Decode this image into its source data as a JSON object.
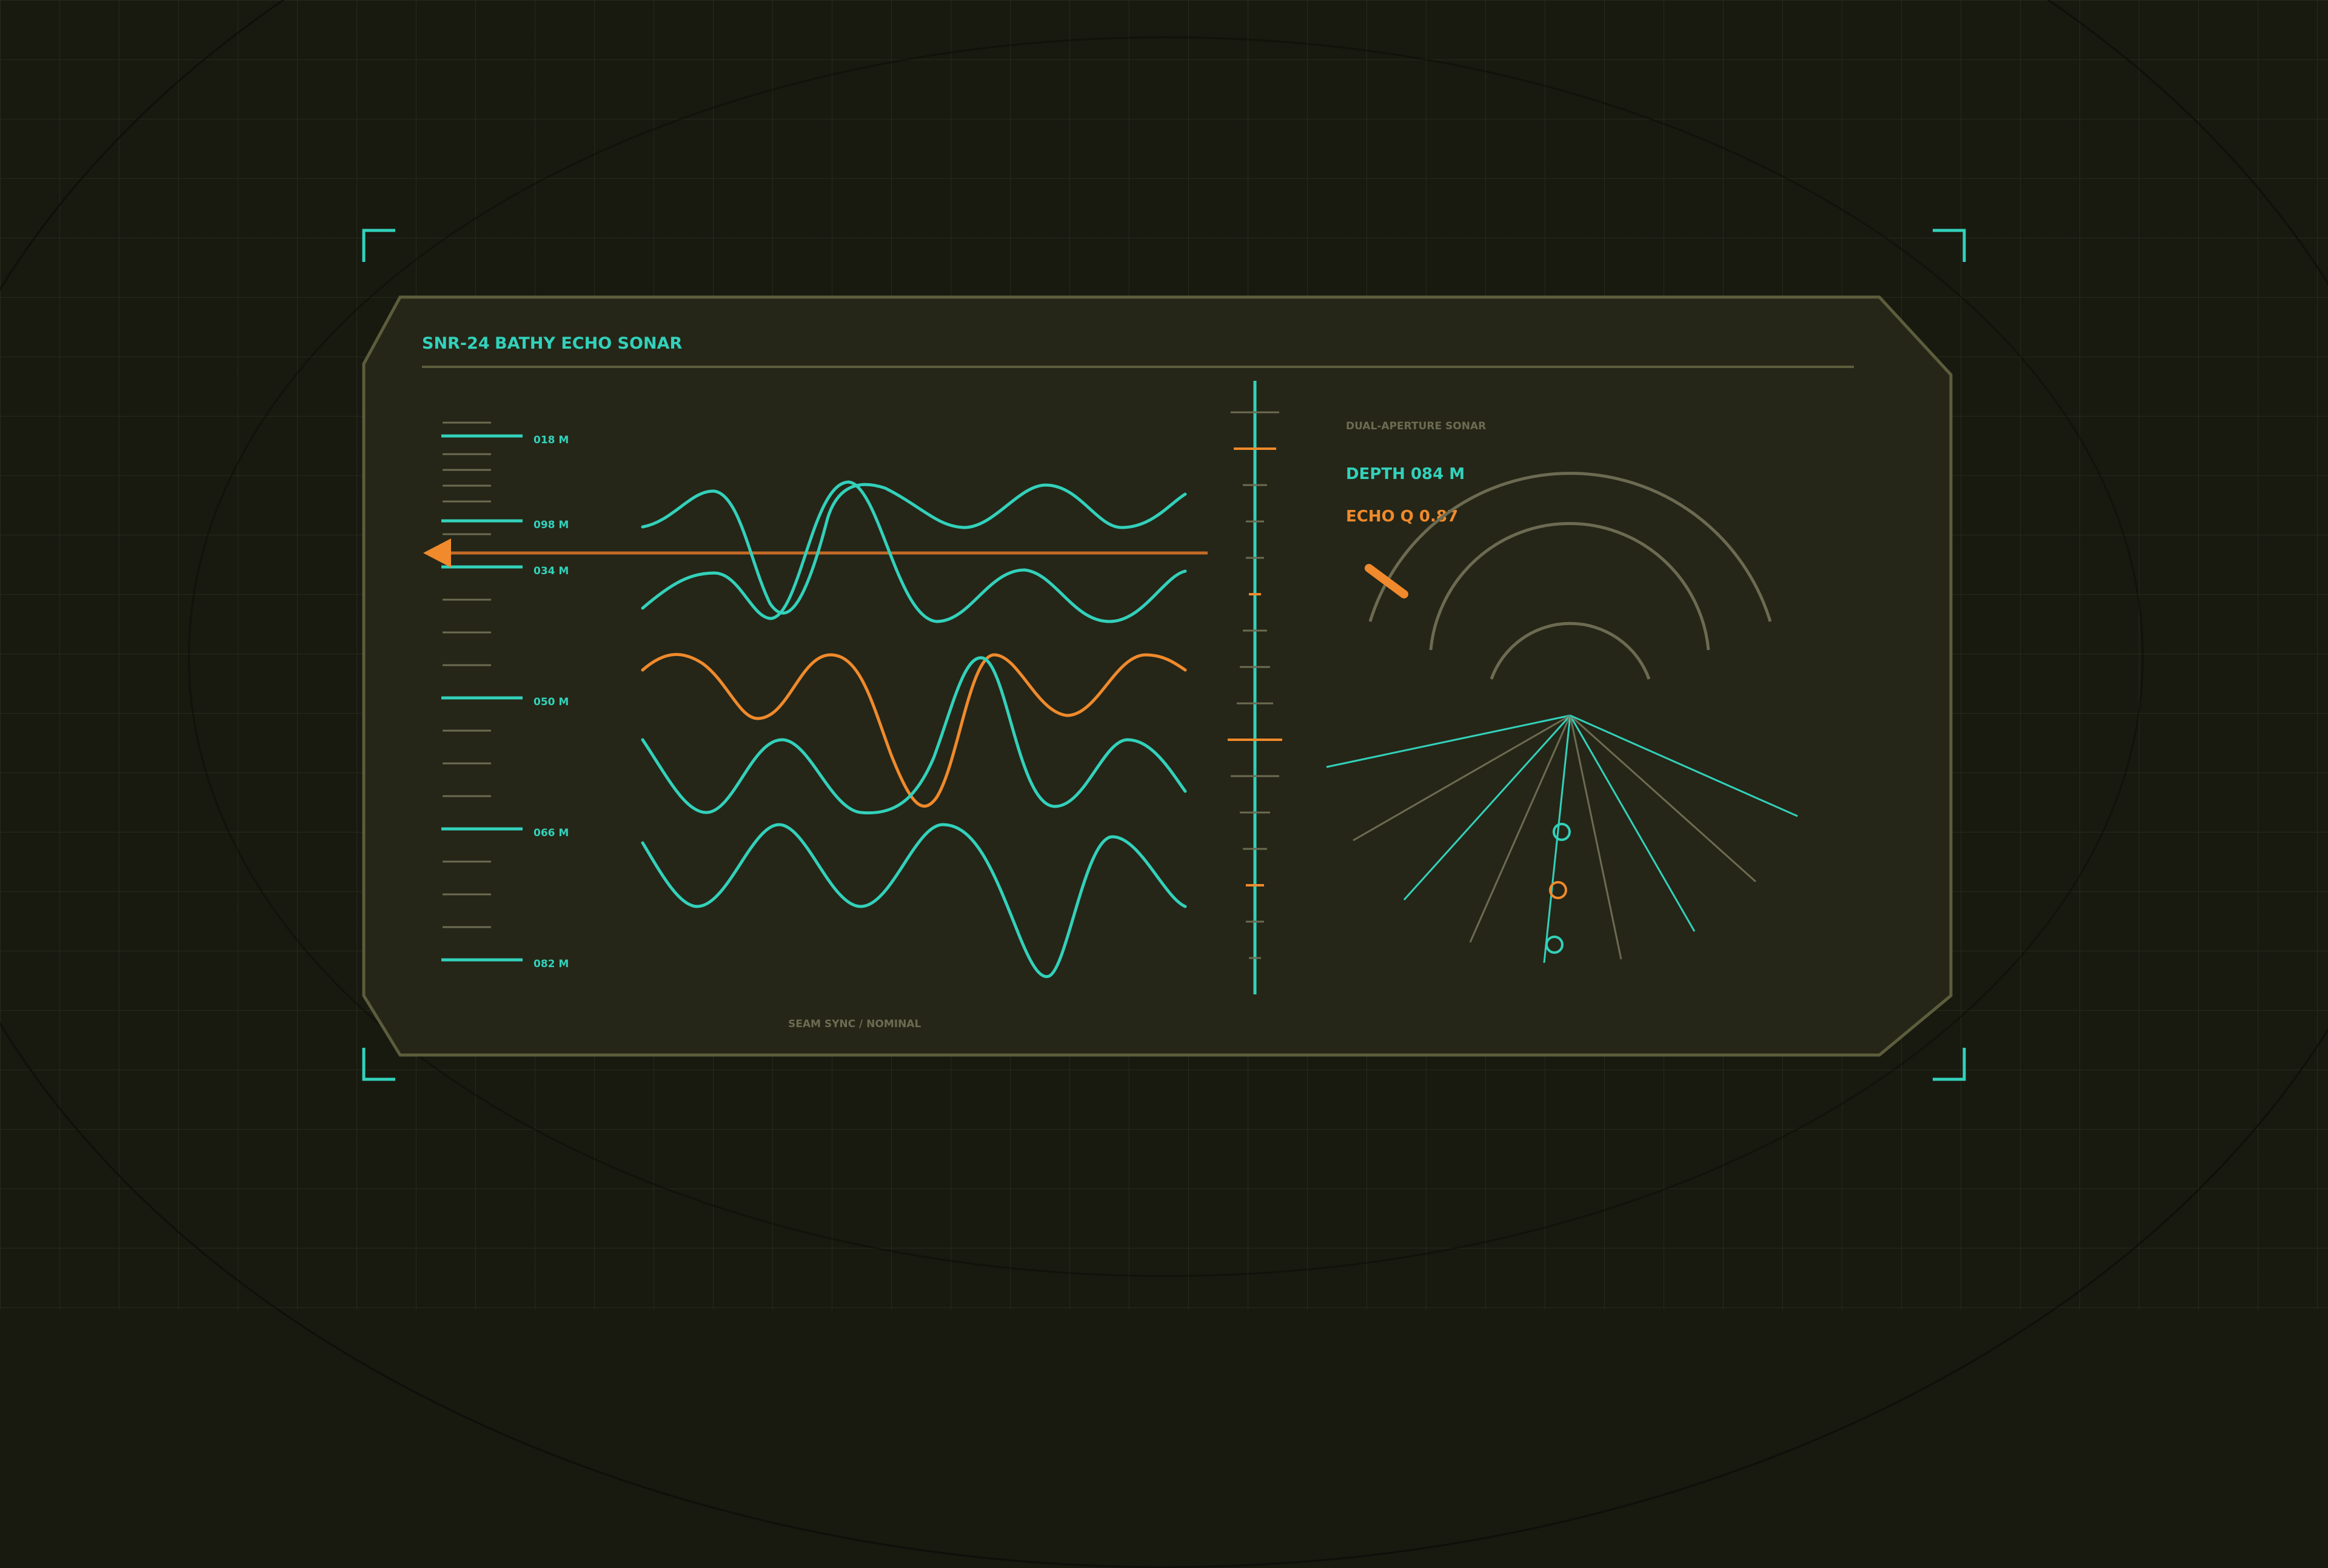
{
  "panel": {
    "title_code": "SNR-24",
    "title_name": "BATHY ECHO SONAR",
    "footer_status": "SEAM SYNC / NOMINAL"
  },
  "depth_scale": {
    "labels": [
      "018 M",
      "098 M",
      "034 M",
      "050 M",
      "066 M",
      "082 M"
    ]
  },
  "sonar": {
    "mode_label": "DUAL-APERTURE SONAR",
    "depth_readout": "DEPTH 084 M",
    "echo_readout": "ECHO Q 0.87"
  },
  "colors": {
    "accent": "#33d1bb",
    "alert": "#f08a2c",
    "frame": "#5c5d3c",
    "panel_bg": "#252617",
    "muted": "#6c6b52"
  }
}
